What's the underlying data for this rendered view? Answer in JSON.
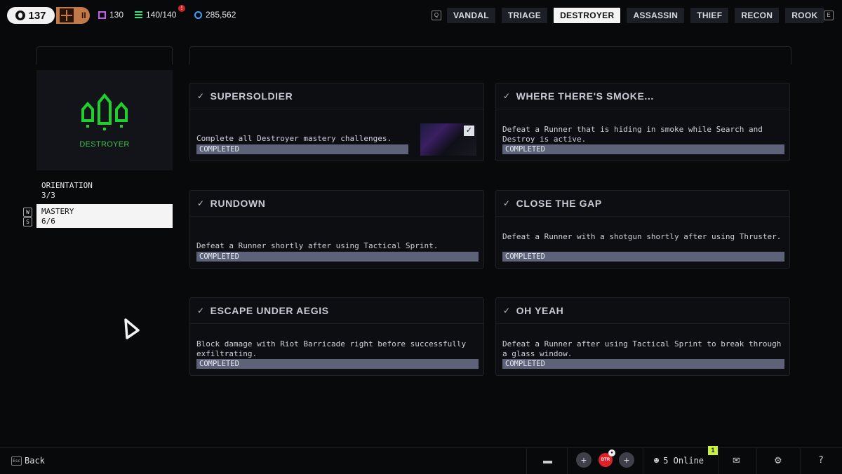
{
  "topbar": {
    "level": "137",
    "rank": "II",
    "stats": {
      "purple": "130",
      "green": "140/140",
      "blue": "285,562"
    },
    "alert": "!",
    "key_left": "Q",
    "key_right": "E",
    "tabs": [
      "VANDAL",
      "TRIAGE",
      "DESTROYER",
      "ASSASSIN",
      "THIEF",
      "RECON",
      "ROOK"
    ],
    "active_tab": "DESTROYER"
  },
  "sidebar": {
    "class_name": "DESTROYER",
    "icon": "destroyer-emblem-icon",
    "icon_color": "#1fd02c",
    "items": [
      {
        "label": "ORIENTATION",
        "progress": "3/3"
      },
      {
        "label": "MASTERY",
        "progress": "6/6"
      }
    ],
    "keys": [
      "W",
      "S"
    ]
  },
  "challenges": [
    {
      "title": "SUPERSOLDIER",
      "desc": "Complete all Destroyer mastery challenges.",
      "status": "COMPLETED"
    },
    {
      "title": "WHERE THERE'S SMOKE...",
      "desc": "Defeat a Runner that is hiding in smoke while Search and Destroy is active.",
      "status": "COMPLETED"
    },
    {
      "title": "RUNDOWN",
      "desc": "Defeat a Runner shortly after using Tactical Sprint.",
      "status": "COMPLETED"
    },
    {
      "title": "CLOSE THE GAP",
      "desc": "Defeat a Runner with a shotgun shortly after using Thruster.",
      "status": "COMPLETED"
    },
    {
      "title": "ESCAPE UNDER AEGIS",
      "desc": "Block damage with Riot Barricade right before successfully exfiltrating.",
      "status": "COMPLETED"
    },
    {
      "title": "OH YEAH",
      "desc": "Defeat a Runner after using Tactical Sprint to break through a glass window.",
      "status": "COMPLETED"
    }
  ],
  "reward_check": "✓",
  "bottombar": {
    "back_key": "Esc",
    "back_label": "Back",
    "online": "5 Online",
    "notifications": "1",
    "help": "?"
  }
}
